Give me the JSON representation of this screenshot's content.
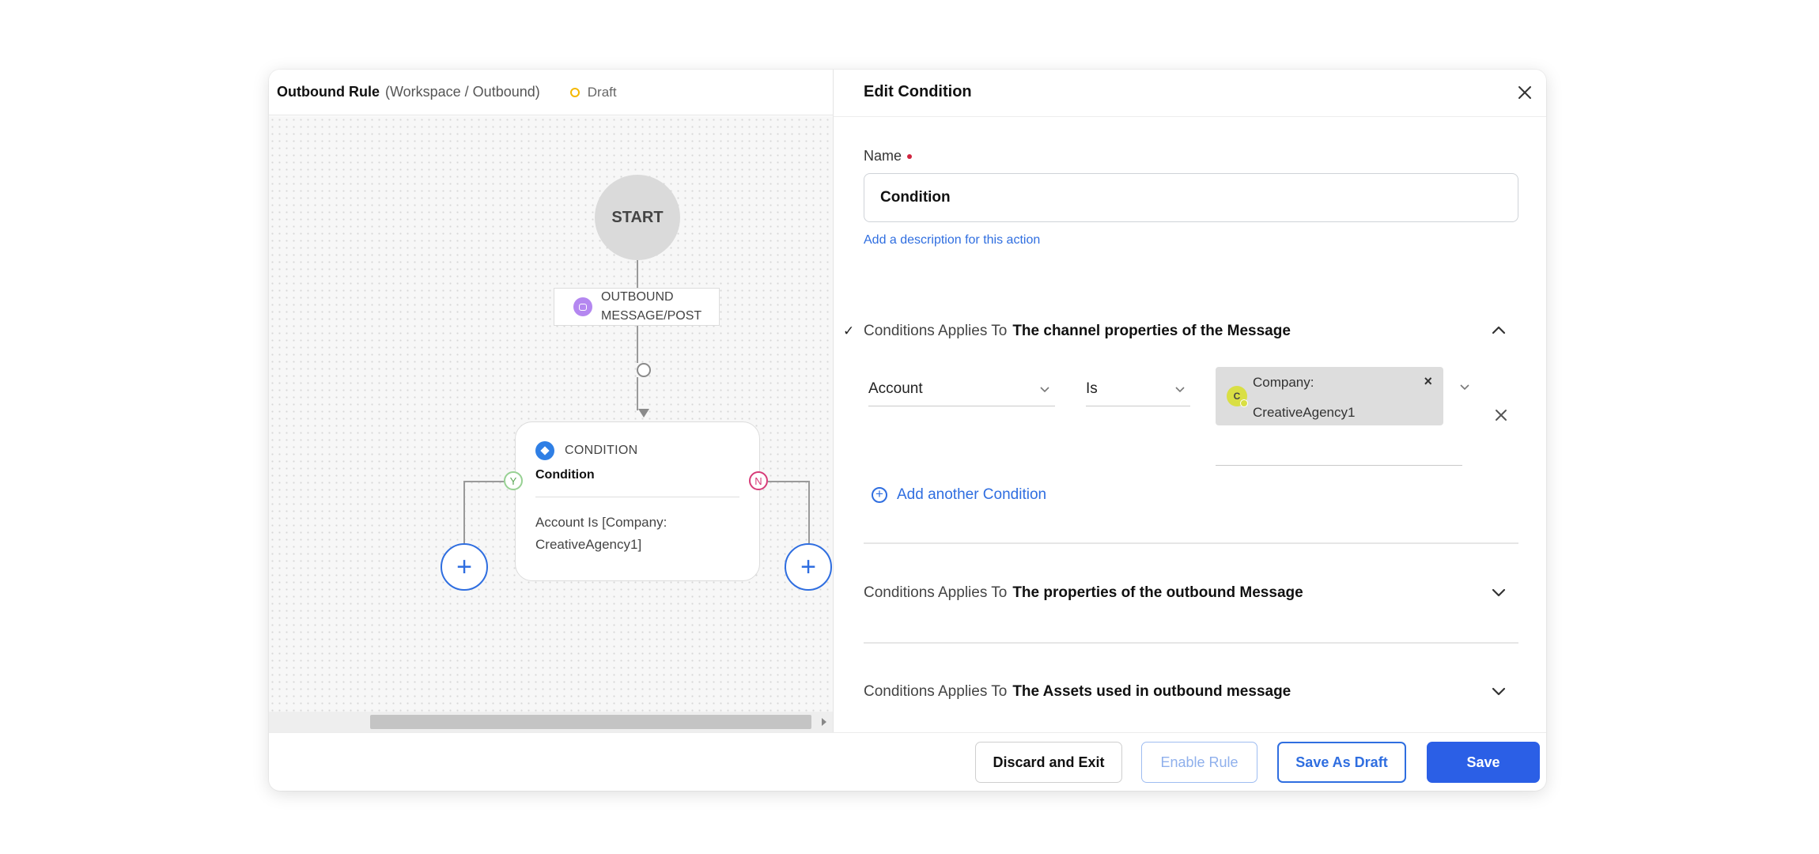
{
  "header": {
    "title": "Outbound Rule",
    "path": "(Workspace / Outbound)",
    "status": "Draft",
    "status_color": "#f5b800"
  },
  "canvas": {
    "start_label": "START",
    "outbound_node": {
      "icon": "message-icon",
      "label": "OUTBOUND MESSAGE/POST",
      "icon_color": "#b487f0"
    },
    "condition_node": {
      "icon": "diamond-icon",
      "type_label": "CONDITION",
      "name": "Condition",
      "description": "Account Is [Company: CreativeAgency1]",
      "icon_color": "#2f7fe5"
    },
    "branches": {
      "yes": "Y",
      "no": "N",
      "yes_color": "#5aa655",
      "no_color": "#d73b78"
    },
    "add_button_symbol": "+"
  },
  "panel": {
    "title": "Edit Condition",
    "name_label": "Name",
    "name_value": "Condition",
    "description_link": "Add a description for this action",
    "sections": [
      {
        "prefix": "Conditions Applies To",
        "title": "The channel properties of the Message",
        "expanded": true,
        "checked": true,
        "check_mark": "✓"
      },
      {
        "prefix": "Conditions Applies To",
        "title": "The properties of the outbound Message",
        "expanded": false
      },
      {
        "prefix": "Conditions Applies To",
        "title": "The Assets used in outbound message",
        "expanded": false
      }
    ],
    "condition_row": {
      "field": "Account",
      "operator": "Is",
      "value_chip": {
        "avatar_letter": "C",
        "line1": "Company:",
        "line2": "CreativeAgency1",
        "remove_symbol": "×"
      }
    },
    "add_condition_label": "Add another Condition",
    "add_condition_symbol": "+"
  },
  "footer": {
    "discard_label": "Discard and Exit",
    "enable_label": "Enable Rule",
    "draft_label": "Save As Draft",
    "save_label": "Save"
  },
  "colors": {
    "accent": "#2b5fe6",
    "link": "#2f6ee0",
    "required": "#d0243f"
  }
}
